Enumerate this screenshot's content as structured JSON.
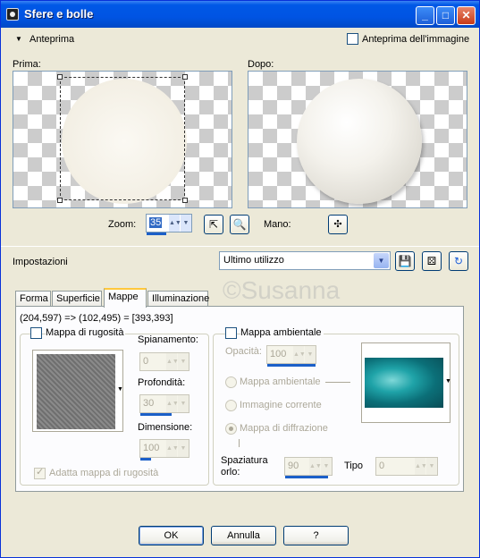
{
  "window": {
    "title": "Sfere e bolle"
  },
  "preview": {
    "section_label": "Anteprima",
    "image_preview_label": "Anteprima dell'immagine",
    "before_label": "Prima:",
    "after_label": "Dopo:",
    "zoom_label": "Zoom:",
    "zoom_value": "35",
    "hand_label": "Mano:"
  },
  "settings": {
    "label": "Impostazioni",
    "preset_value": "Ultimo utilizzo"
  },
  "tabs": [
    "Forma",
    "Superficie",
    "Mappe",
    "Illuminazione"
  ],
  "watermark": "©Susanna",
  "mappe": {
    "coords": "(204,597) => (102,495) = [393,393]",
    "bump": {
      "checkbox_label": "Mappa di rugosità",
      "smoothing_label": "Spianamento:",
      "smoothing_value": "0",
      "depth_label": "Profondità:",
      "depth_value": "30",
      "size_label": "Dimensione:",
      "size_value": "100",
      "fit_label": "Adatta mappa di rugosità"
    },
    "env": {
      "checkbox_label": "Mappa ambientale",
      "opacity_label": "Opacità:",
      "opacity_value": "100",
      "radio_env": "Mappa ambientale",
      "radio_current": "Immagine corrente",
      "radio_diffraction": "Mappa di diffrazione",
      "spacing_label_1": "Spaziatura",
      "spacing_label_2": "orlo:",
      "spacing_value": "90",
      "type_label": "Tipo",
      "type_value": "0"
    }
  },
  "buttons": {
    "ok": "OK",
    "cancel": "Annulla",
    "help": "?"
  }
}
